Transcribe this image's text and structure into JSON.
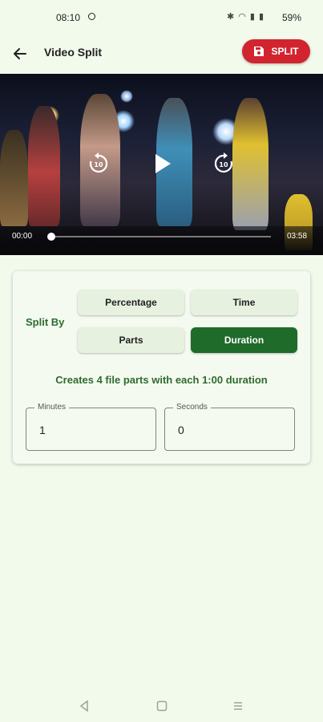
{
  "status": {
    "time": "08:10",
    "icons": "✱ ◠ ▮ ▮",
    "battery": "59%"
  },
  "appbar": {
    "title": "Video Split",
    "split_label": "SPLIT"
  },
  "player": {
    "current_time": "00:00",
    "total_time": "03:58",
    "progress": 0.0
  },
  "options": {
    "split_by_label": "Split By",
    "items": [
      {
        "label": "Percentage",
        "selected": false
      },
      {
        "label": "Time",
        "selected": false
      },
      {
        "label": "Parts",
        "selected": false
      },
      {
        "label": "Duration",
        "selected": true
      }
    ],
    "description": "Creates 4 file parts with each 1:00 duration"
  },
  "fields": {
    "minutes": {
      "label": "Minutes",
      "value": "1"
    },
    "seconds": {
      "label": "Seconds",
      "value": "0"
    }
  },
  "colors": {
    "accent": "#1f6b2a",
    "split_button": "#d1242f",
    "background": "#f2faec"
  }
}
